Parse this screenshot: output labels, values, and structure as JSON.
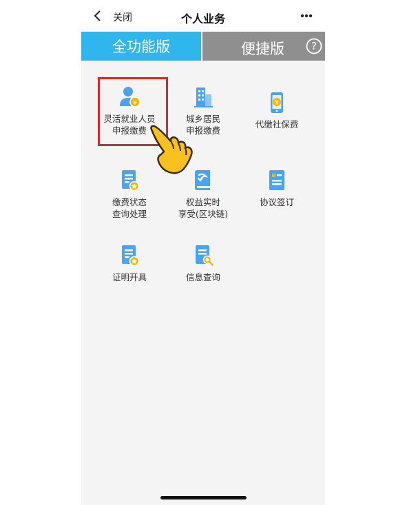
{
  "navbar": {
    "close_label": "关闭",
    "title": "个人业务",
    "more_icon": "more-dots-icon",
    "back_icon": "chevron-left-icon"
  },
  "tabs": {
    "full_label": "全功能版",
    "quick_label": "便捷版",
    "help_glyph": "?",
    "active_color": "#2fb6ec",
    "inactive_color": "#8f8f8f"
  },
  "items": [
    {
      "line1": "灵活就业人员",
      "line2": "申报缴费",
      "icon": "person-yuan-icon"
    },
    {
      "line1": "城乡居民",
      "line2": "申报缴费",
      "icon": "buildings-icon"
    },
    {
      "line1": "代缴社保费",
      "line2": "",
      "icon": "phone-yuan-icon"
    },
    {
      "line1": "缴费状态",
      "line2": "查询处理",
      "icon": "document-star-icon"
    },
    {
      "line1": "权益实时",
      "line2": "享受(区块链)",
      "icon": "book-icon"
    },
    {
      "line1": "协议签订",
      "line2": "",
      "icon": "document-list-icon"
    },
    {
      "line1": "证明开具",
      "line2": "",
      "icon": "certificate-star-icon"
    },
    {
      "line1": "信息查询",
      "line2": "",
      "icon": "document-search-icon"
    }
  ],
  "colors": {
    "icon_blue": "#4aa3ee",
    "icon_gold": "#f2b705",
    "highlight_red": "#d62a2a"
  }
}
